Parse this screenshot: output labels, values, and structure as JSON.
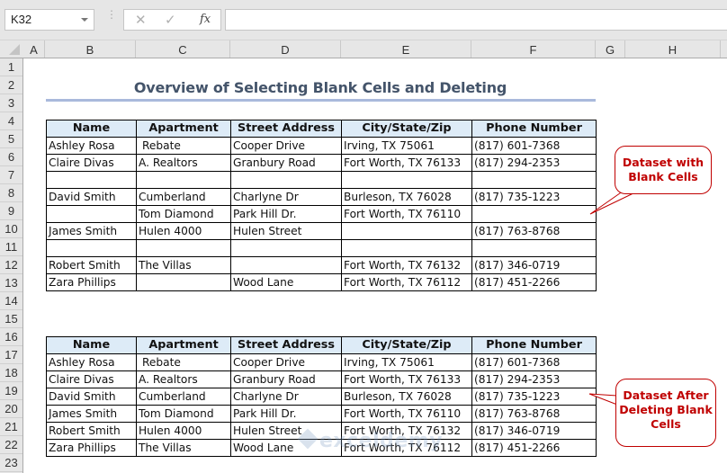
{
  "formula_bar": {
    "name_box": "K32",
    "cancel_icon": "✕",
    "enter_icon": "✓",
    "fx_label": "fx",
    "formula": ""
  },
  "columns": [
    "A",
    "B",
    "C",
    "D",
    "E",
    "F",
    "G",
    "H"
  ],
  "rows": [
    "1",
    "2",
    "3",
    "4",
    "5",
    "6",
    "7",
    "8",
    "9",
    "10",
    "11",
    "12",
    "13",
    "14",
    "15",
    "16",
    "17",
    "18",
    "19",
    "20",
    "21",
    "22",
    "23"
  ],
  "title": "Overview of Selecting Blank Cells and Deleting",
  "headers": [
    "Name",
    "Apartment",
    "Street Address",
    "City/State/Zip",
    "Phone Number"
  ],
  "dataset_with_blanks": [
    [
      "Ashley Rosa",
      " Rebate",
      "Cooper Drive",
      "Irving, TX 75061",
      "(817) 601-7368"
    ],
    [
      "Claire Divas",
      "A. Realtors",
      "Granbury Road",
      "Fort Worth, TX 76133",
      "(817) 294-2353"
    ],
    [
      "",
      "",
      "",
      "",
      ""
    ],
    [
      "David Smith",
      "Cumberland",
      "Charlyne Dr",
      "Burleson, TX 76028",
      "(817) 735-1223"
    ],
    [
      "",
      "Tom Diamond",
      "Park Hill Dr.",
      "Fort Worth, TX 76110",
      ""
    ],
    [
      "James Smith",
      "Hulen 4000",
      "Hulen Street",
      "",
      "(817) 763-8768"
    ],
    [
      "",
      "",
      "",
      "",
      ""
    ],
    [
      "Robert Smith",
      "The Villas",
      "",
      "Fort Worth, TX 76132",
      "(817) 346-0719"
    ],
    [
      "Zara Phillips",
      "",
      "Wood Lane",
      "Fort Worth, TX 76112",
      "(817) 451-2266"
    ]
  ],
  "dataset_after_deleting": [
    [
      "Ashley Rosa",
      " Rebate",
      "Cooper Drive",
      "Irving, TX 75061",
      "(817) 601-7368"
    ],
    [
      "Claire Divas",
      "A. Realtors",
      "Granbury Road",
      "Fort Worth, TX 76133",
      "(817) 294-2353"
    ],
    [
      "David Smith",
      "Cumberland",
      "Charlyne Dr",
      "Burleson, TX 76028",
      "(817) 735-1223"
    ],
    [
      "James Smith",
      "Tom Diamond",
      "Park Hill Dr.",
      "Fort Worth, TX 76110",
      "(817) 763-8768"
    ],
    [
      "Robert Smith",
      "Hulen 4000",
      "Hulen Street",
      "Fort Worth, TX 76132",
      "(817) 346-0719"
    ],
    [
      "Zara Phillips",
      "The Villas",
      "Wood Lane",
      "Fort Worth, TX 76112",
      "(817) 451-2266"
    ]
  ],
  "callouts": {
    "with_blanks": [
      "Dataset with",
      "Blank Cells"
    ],
    "after_deleting": [
      "Dataset After",
      "Deleting Blank",
      "Cells"
    ]
  },
  "colors": {
    "title": "#44546a",
    "header_fill": "#ddebf7",
    "callout": "#c00000"
  },
  "watermark": "exceldemy"
}
